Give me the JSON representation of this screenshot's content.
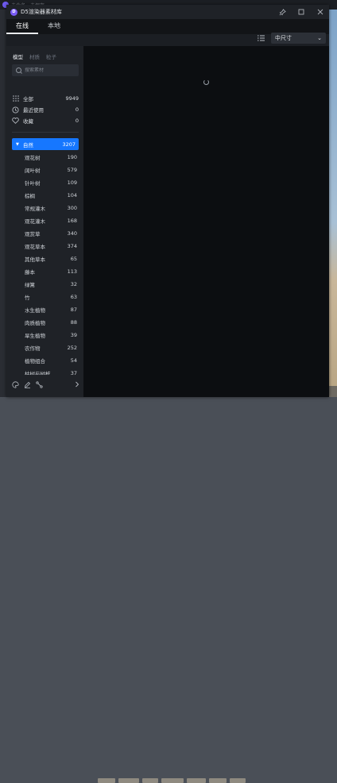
{
  "background": {
    "logo": "D",
    "title": "未命名 - 未保存"
  },
  "window": {
    "title": "D5渲染器素材库",
    "buttons": [
      "pin-icon",
      "maximize-icon",
      "close-icon"
    ]
  },
  "tabs": [
    {
      "label": "在线",
      "active": true
    },
    {
      "label": "本地",
      "active": false
    }
  ],
  "toolbar": {
    "size_value": "中尺寸",
    "size_arrow": "⌄"
  },
  "sidebar": {
    "subtabs": [
      {
        "label": "模型",
        "active": true
      },
      {
        "label": "材质",
        "active": false
      },
      {
        "label": "粒子",
        "active": false
      }
    ],
    "search_placeholder": "搜索素材",
    "quick": [
      {
        "icon": "grid-icon",
        "label": "全部",
        "count": "9949"
      },
      {
        "icon": "clock-icon",
        "label": "最近使用",
        "count": "0"
      },
      {
        "icon": "heart-icon",
        "label": "收藏",
        "count": "0"
      }
    ],
    "category": {
      "label": "自然",
      "count": "3207"
    },
    "items": [
      {
        "label": "观花树",
        "count": "190"
      },
      {
        "label": "阔叶树",
        "count": "579"
      },
      {
        "label": "针叶树",
        "count": "109"
      },
      {
        "label": "棕榈",
        "count": "104"
      },
      {
        "label": "常规灌木",
        "count": "300"
      },
      {
        "label": "观花灌木",
        "count": "168"
      },
      {
        "label": "观赏草",
        "count": "340"
      },
      {
        "label": "观花草本",
        "count": "374"
      },
      {
        "label": "其他草本",
        "count": "65"
      },
      {
        "label": "藤本",
        "count": "113"
      },
      {
        "label": "绿篱",
        "count": "32"
      },
      {
        "label": "竹",
        "count": "63"
      },
      {
        "label": "水生植物",
        "count": "87"
      },
      {
        "label": "肉质植物",
        "count": "88"
      },
      {
        "label": "旱生植物",
        "count": "39"
      },
      {
        "label": "农作物",
        "count": "252"
      },
      {
        "label": "植物组合",
        "count": "54"
      },
      {
        "label": "枯树与树桩",
        "count": "37"
      }
    ]
  }
}
